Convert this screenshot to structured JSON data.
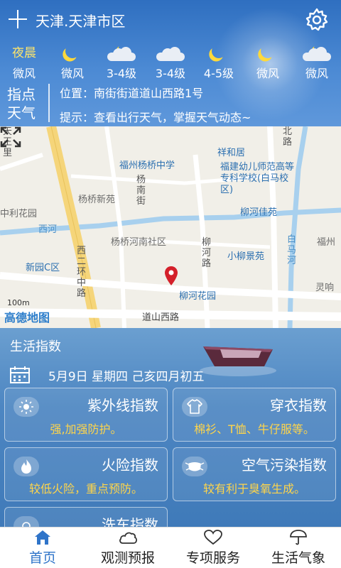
{
  "header": {
    "city": "天津.天津市区",
    "forecast": [
      {
        "label": "夜晨",
        "icon": "text-label",
        "wind": "微风"
      },
      {
        "label": "",
        "icon": "moon-icon",
        "wind": "微风"
      },
      {
        "label": "",
        "icon": "cloudy-night-icon",
        "wind": "3-4级"
      },
      {
        "label": "",
        "icon": "cloud-icon",
        "wind": "3-4级"
      },
      {
        "label": "",
        "icon": "moon-icon",
        "wind": "4-5级"
      },
      {
        "label": "",
        "icon": "moon-icon",
        "wind": "微风"
      },
      {
        "label": "",
        "icon": "cloudy-night-icon",
        "wind": "微风"
      }
    ]
  },
  "hint": {
    "brand": "指点天气",
    "location": "位置：南街街道道山西路1号",
    "tip": "提示：查看出行天气，掌握天气动态~"
  },
  "map": {
    "labels": [
      "天王里",
      "福州杨桥中学",
      "祥和居",
      "福建幼儿师范高等专科学校(白马校区)",
      "杨桥新苑",
      "杨南街",
      "柳河佳苑",
      "中利花园",
      "西河",
      "杨桥河南社区",
      "小柳景苑",
      "福州",
      "西二环中路",
      "柳河路",
      "白马河",
      "新园C区",
      "柳河花园",
      "灵响",
      "道山西路",
      "北路"
    ],
    "scale": "100m",
    "logo": "高德地图"
  },
  "life": {
    "title": "生活指数",
    "date": "5月9日  星期四  己亥四月初五",
    "cards": [
      {
        "name": "紫外线指数",
        "desc": "强,加强防护。",
        "icon": "sun-icon"
      },
      {
        "name": "穿衣指数",
        "desc": "棉衫、T恤、牛仔服等。",
        "icon": "shirt-icon"
      },
      {
        "name": "火险指数",
        "desc": "较低火险，重点预防。",
        "icon": "fire-icon"
      },
      {
        "name": "空气污染指数",
        "desc": "较有利于臭氧生成。",
        "icon": "mask-icon"
      },
      {
        "name": "洗车指数",
        "desc": "",
        "icon": "car-wash-icon"
      }
    ]
  },
  "nav": {
    "items": [
      {
        "label": "首页",
        "icon": "home-icon",
        "active": true
      },
      {
        "label": "观测预报",
        "icon": "cloud-icon"
      },
      {
        "label": "专项服务",
        "icon": "heart-icon"
      },
      {
        "label": "生活气象",
        "icon": "umbrella-icon"
      }
    ]
  },
  "colors": {
    "header": "#3f7ccc",
    "accent": "#ffd54a",
    "nav_active": "#2f74c9"
  }
}
